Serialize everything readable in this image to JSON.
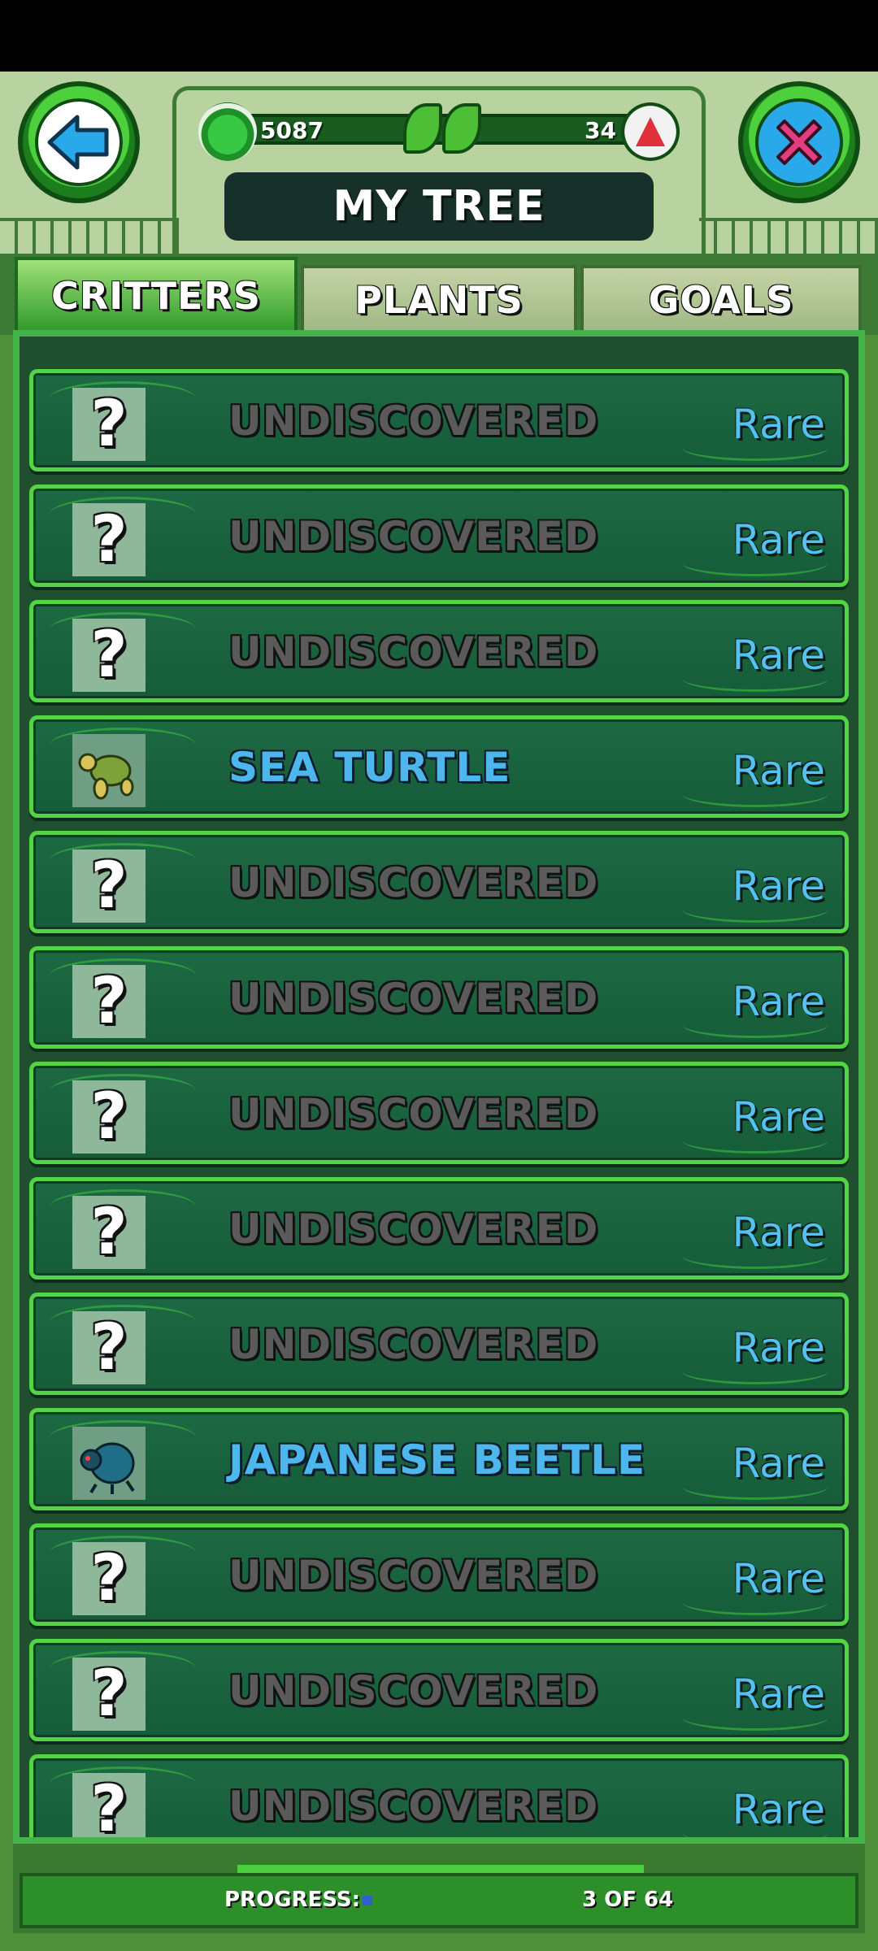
{
  "header": {
    "title": "MY TREE",
    "coins": "5087",
    "gems": "34",
    "back_icon": "left-arrow-icon",
    "close_icon": "close-x-icon",
    "coin_icon": "green-gem-icon",
    "gem_icon": "red-crystal-icon"
  },
  "tabs": [
    {
      "label": "CRITTERS",
      "active": true
    },
    {
      "label": "PLANTS",
      "active": false
    },
    {
      "label": "GOALS",
      "active": false
    }
  ],
  "critters": [
    {
      "name": "UNDISCOVERED",
      "rarity": "Rare",
      "discovered": false,
      "icon": "question-mark-icon"
    },
    {
      "name": "UNDISCOVERED",
      "rarity": "Rare",
      "discovered": false,
      "icon": "question-mark-icon"
    },
    {
      "name": "UNDISCOVERED",
      "rarity": "Rare",
      "discovered": false,
      "icon": "question-mark-icon"
    },
    {
      "name": "SEA TURTLE",
      "rarity": "Rare",
      "discovered": true,
      "icon": "sea-turtle-icon"
    },
    {
      "name": "UNDISCOVERED",
      "rarity": "Rare",
      "discovered": false,
      "icon": "question-mark-icon"
    },
    {
      "name": "UNDISCOVERED",
      "rarity": "Rare",
      "discovered": false,
      "icon": "question-mark-icon"
    },
    {
      "name": "UNDISCOVERED",
      "rarity": "Rare",
      "discovered": false,
      "icon": "question-mark-icon"
    },
    {
      "name": "UNDISCOVERED",
      "rarity": "Rare",
      "discovered": false,
      "icon": "question-mark-icon"
    },
    {
      "name": "UNDISCOVERED",
      "rarity": "Rare",
      "discovered": false,
      "icon": "question-mark-icon"
    },
    {
      "name": "JAPANESE BEETLE",
      "rarity": "Rare",
      "discovered": true,
      "icon": "japanese-beetle-icon"
    },
    {
      "name": "UNDISCOVERED",
      "rarity": "Rare",
      "discovered": false,
      "icon": "question-mark-icon"
    },
    {
      "name": "UNDISCOVERED",
      "rarity": "Rare",
      "discovered": false,
      "icon": "question-mark-icon"
    },
    {
      "name": "UNDISCOVERED",
      "rarity": "Rare",
      "discovered": false,
      "icon": "question-mark-icon"
    }
  ],
  "footer": {
    "progress_label": "PROGRESS:",
    "progress_text": "3 OF 64",
    "progress_fraction": 0.047,
    "progress_color": "#3060d0"
  },
  "colors": {
    "rarity": "#55c1f0",
    "discovered_name": "#4db6ec",
    "undiscovered_name": "#5a5a5a",
    "row_border": "#52d445"
  }
}
